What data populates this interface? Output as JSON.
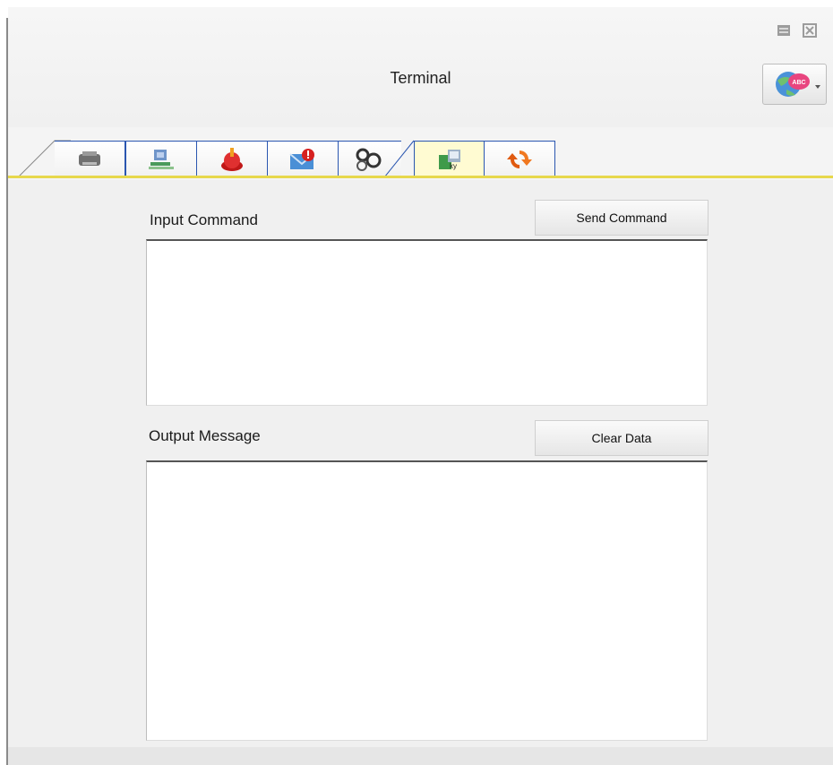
{
  "window": {
    "title": "Terminal",
    "minimize_icon": "minimize-icon",
    "close_icon": "close-icon",
    "language_icon": "globe-abc-icon"
  },
  "tabs": [
    {
      "icon": "printer-icon",
      "active": false
    },
    {
      "icon": "network-icon",
      "active": false
    },
    {
      "icon": "alert-icon",
      "active": false
    },
    {
      "icon": "message-alert-icon",
      "active": false
    },
    {
      "icon": "settings-icon",
      "active": false
    },
    {
      "icon": "terminal-icon",
      "active": true
    },
    {
      "icon": "refresh-icon",
      "active": false
    }
  ],
  "input": {
    "label": "Input Command",
    "send_label": "Send Command",
    "value": ""
  },
  "output": {
    "label": "Output Message",
    "clear_label": "Clear Data",
    "value": ""
  },
  "colors": {
    "tab_border": "#2a56b0",
    "active_tab": "#fffbd2",
    "tab_underline": "#e7d84c"
  }
}
